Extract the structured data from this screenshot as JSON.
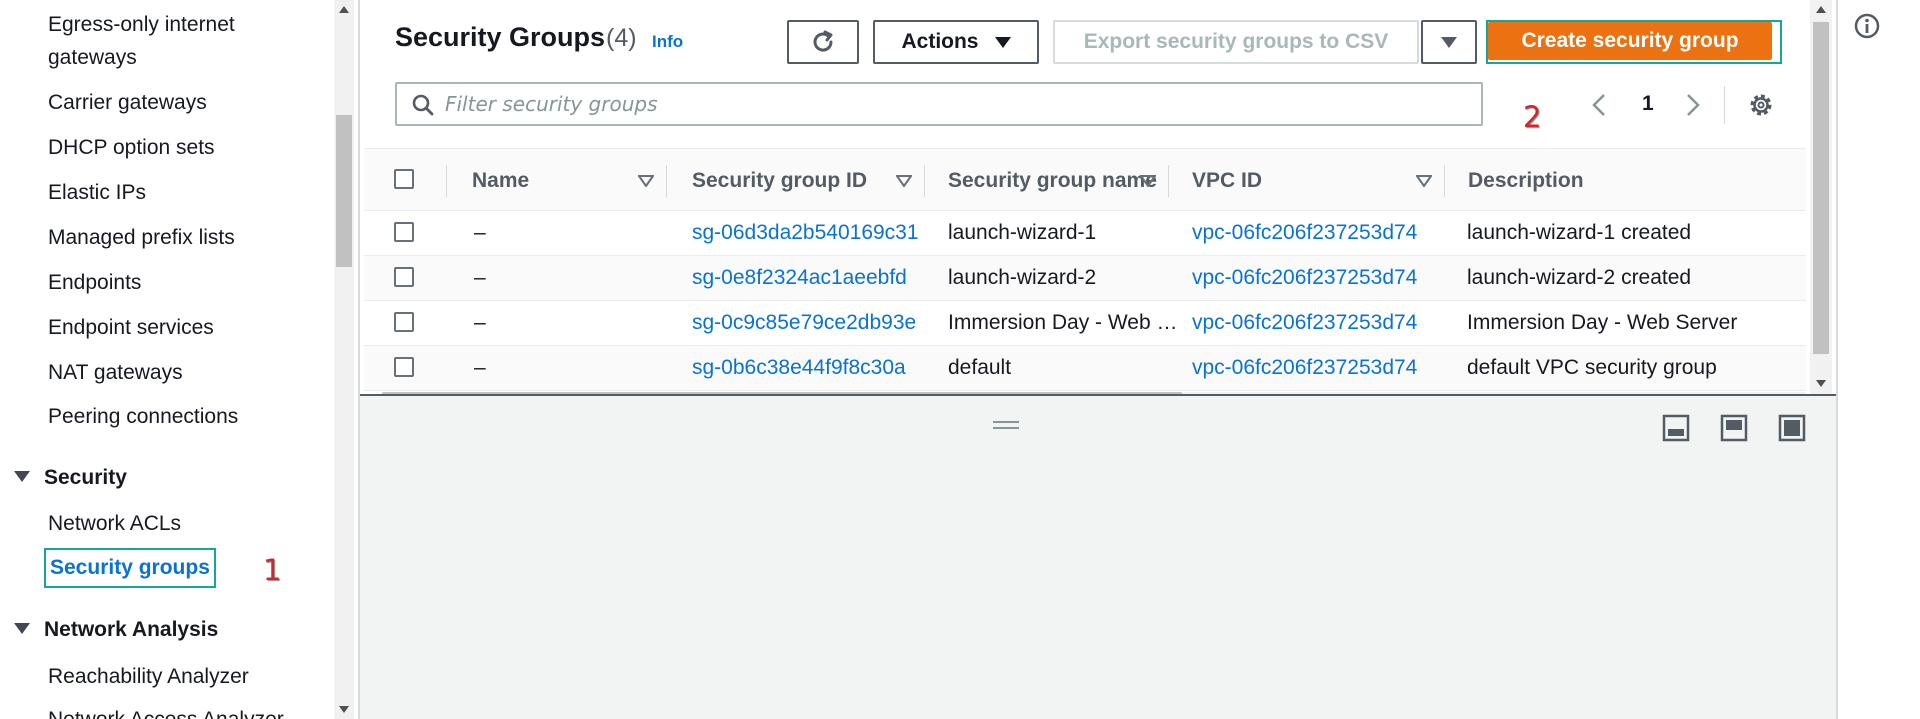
{
  "sidebar": {
    "items": [
      {
        "label_line1": "Egress-only internet",
        "label_line2": "gateways"
      },
      {
        "label": "Carrier gateways"
      },
      {
        "label": "DHCP option sets"
      },
      {
        "label": "Elastic IPs"
      },
      {
        "label": "Managed prefix lists"
      },
      {
        "label": "Endpoints"
      },
      {
        "label": "Endpoint services"
      },
      {
        "label": "NAT gateways"
      },
      {
        "label": "Peering connections"
      }
    ],
    "security_section": "Security",
    "security_items": [
      "Network ACLs",
      "Security groups"
    ],
    "network_analysis_section": "Network Analysis",
    "network_analysis_items": [
      "Reachability Analyzer",
      "Network Access Analyzer"
    ]
  },
  "annotations": {
    "step1": "1",
    "step2": "2"
  },
  "header": {
    "title": "Security Groups",
    "count": "(4)",
    "info": "Info",
    "actions_label": "Actions",
    "export_label": "Export security groups to CSV",
    "create_label": "Create security group"
  },
  "search": {
    "placeholder": "Filter security groups"
  },
  "pagination": {
    "current_page": "1"
  },
  "table": {
    "columns": [
      "Name",
      "Security group ID",
      "Security group name",
      "VPC ID",
      "Description"
    ],
    "rows": [
      {
        "name": "–",
        "sg_id": "sg-06d3da2b540169c31",
        "sg_name": "launch-wizard-1",
        "vpc_id": "vpc-06fc206f237253d74",
        "description": "launch-wizard-1 created"
      },
      {
        "name": "–",
        "sg_id": "sg-0e8f2324ac1aeebfd",
        "sg_name": "launch-wizard-2",
        "vpc_id": "vpc-06fc206f237253d74",
        "description": "launch-wizard-2 created"
      },
      {
        "name": "–",
        "sg_id": "sg-0c9c85e79ce2db93e",
        "sg_name": "Immersion Day - Web …",
        "vpc_id": "vpc-06fc206f237253d74",
        "description": "Immersion Day - Web Server"
      },
      {
        "name": "–",
        "sg_id": "sg-0b6c38e44f9f8c30a",
        "sg_name": "default",
        "vpc_id": "vpc-06fc206f237253d74",
        "description": "default VPC security group"
      }
    ]
  },
  "colors": {
    "primary_button": "#ec7211",
    "link": "#0972d3",
    "highlight_box": "#16a597",
    "annotation": "#d0282a"
  },
  "icons": {
    "refresh": "refresh-icon",
    "search": "search-icon",
    "settings": "gear-icon",
    "info": "info-icon",
    "caret": "caret-down-icon"
  }
}
